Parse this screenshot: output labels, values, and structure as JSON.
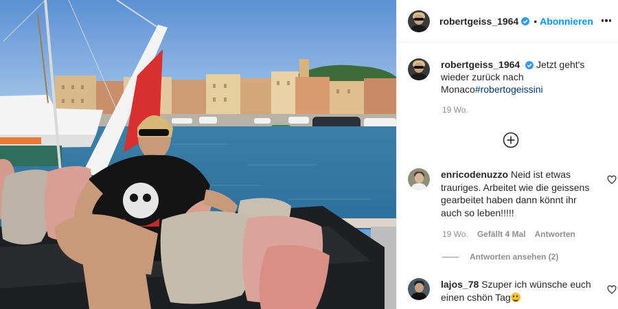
{
  "post": {
    "username": "robertgeiss_1964",
    "follow_label": "Abonnieren",
    "separator": "•",
    "caption_username": "robertgeiss_1964",
    "caption_text": "Jetzt geht's wieder zurück nach Monaco",
    "caption_hashtag": "#robertogeissini",
    "caption_time": "19 Wo."
  },
  "comments": [
    {
      "username": "enricodenuzzo",
      "text": "Neid ist etwas trauriges. Arbeitet wie die geissens gearbeitet haben dann könnt ihr auch so leben!!!!!",
      "time": "19 Wo.",
      "likes": "Gefällt 4 Mal",
      "reply": "Antworten",
      "view_replies": "Antworten ansehen (2)"
    },
    {
      "username": "lajos_78",
      "text": "Szuper ich wünsche euch einen cshön Tag"
    }
  ],
  "icons": {
    "verified": "verified-badge-icon",
    "more": "more-options-icon",
    "load_more": "plus-circle-icon",
    "like": "heart-icon",
    "emoji": "smiling-face-emoji"
  },
  "colors": {
    "accent": "#0095f6",
    "verified": "#3897f0",
    "secondary_text": "#8e8e8e",
    "hashtag": "#00376b"
  }
}
